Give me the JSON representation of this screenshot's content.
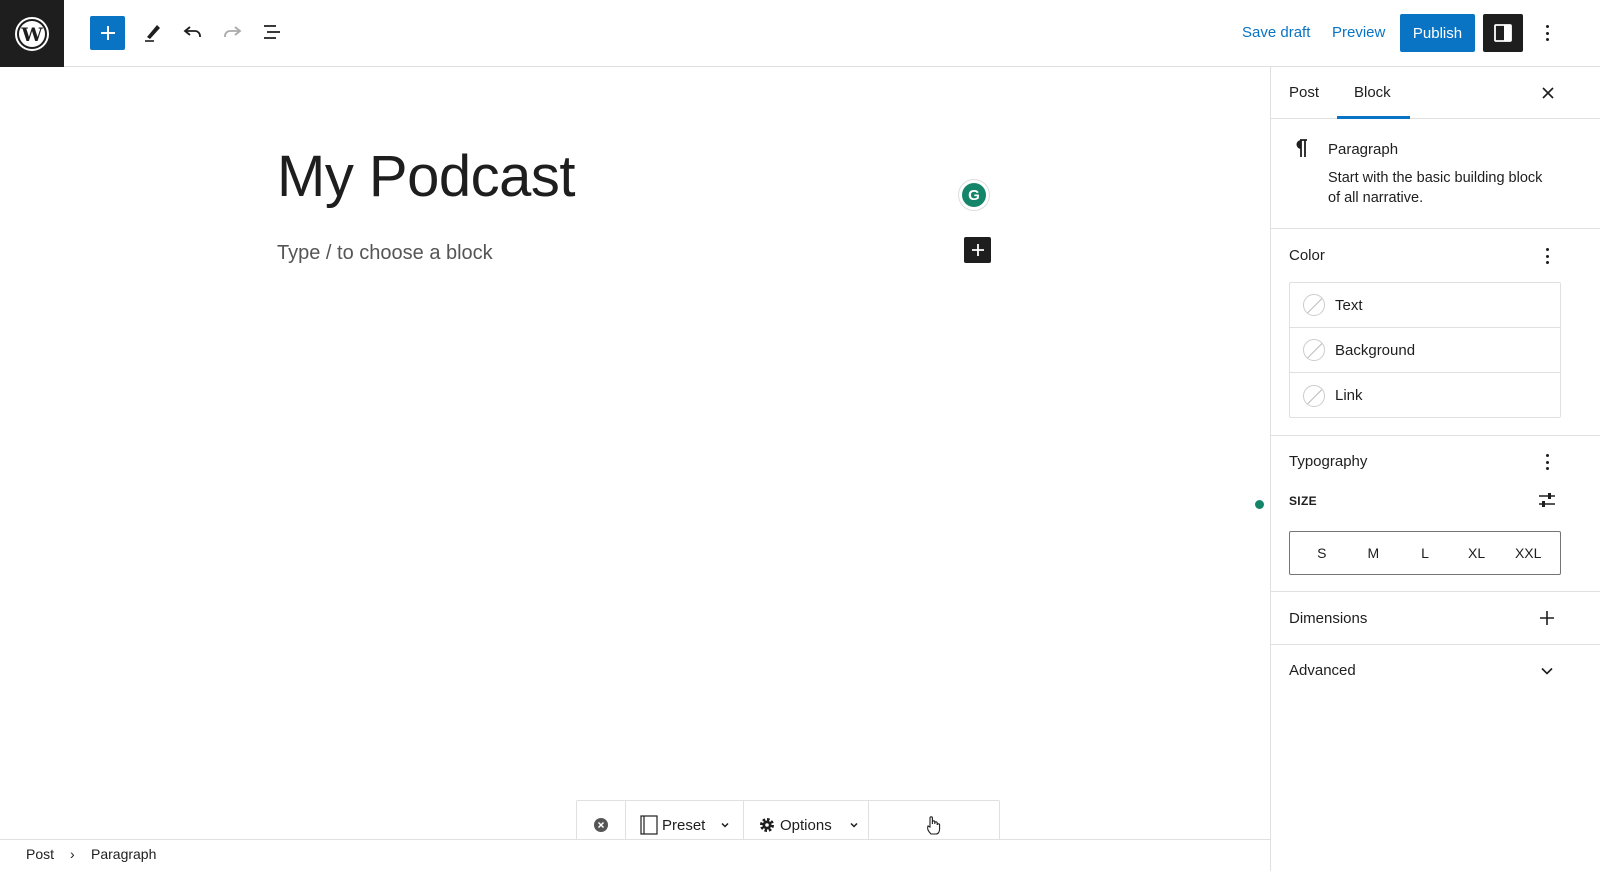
{
  "toolbar": {
    "save_draft": "Save draft",
    "preview": "Preview",
    "publish": "Publish"
  },
  "editor": {
    "title": "My Podcast",
    "placeholder": "Type / to choose a block",
    "grammarly_letter": "G"
  },
  "floating_toolbar": {
    "preset_label": "Preset",
    "options_label": "Options"
  },
  "breadcrumb": {
    "items": [
      "Post",
      "Paragraph"
    ]
  },
  "sidebar": {
    "tabs": [
      {
        "label": "Post",
        "active": false
      },
      {
        "label": "Block",
        "active": true
      }
    ],
    "block_card": {
      "title": "Paragraph",
      "description_line1": "Start with the basic building block",
      "description_line2": "of all narrative."
    },
    "color": {
      "title": "Color",
      "items": [
        "Text",
        "Background",
        "Link"
      ]
    },
    "typography": {
      "title": "Typography",
      "size_label": "SIZE",
      "sizes": [
        "S",
        "M",
        "L",
        "XL",
        "XXL"
      ]
    },
    "dimensions": {
      "title": "Dimensions"
    },
    "advanced": {
      "title": "Advanced"
    }
  },
  "colors": {
    "accent": "#0a74c4",
    "dark": "#1e1e1e",
    "grammarly": "#15856a"
  }
}
